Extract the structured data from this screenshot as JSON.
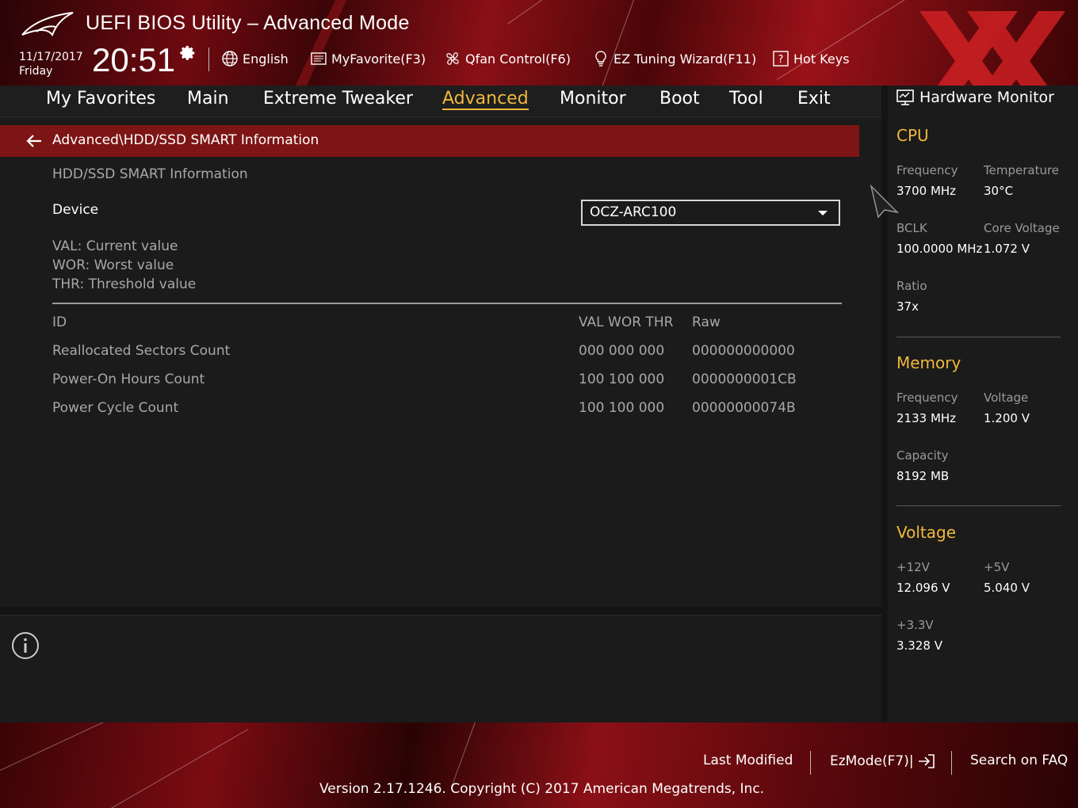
{
  "header": {
    "title": "UEFI BIOS Utility – Advanced Mode",
    "date": "11/17/2017",
    "day": "Friday",
    "time": "20:51",
    "toolbar": [
      {
        "label": "English",
        "icon": "globe-icon"
      },
      {
        "label": "MyFavorite(F3)",
        "icon": "favorite-list-icon"
      },
      {
        "label": "Qfan Control(F6)",
        "icon": "fan-icon"
      },
      {
        "label": "EZ Tuning Wizard(F11)",
        "icon": "lightbulb-icon"
      },
      {
        "label": "Hot Keys",
        "icon": "question-box-icon"
      }
    ]
  },
  "tabs": [
    {
      "label": "My Favorites",
      "active": false
    },
    {
      "label": "Main",
      "active": false
    },
    {
      "label": "Extreme Tweaker",
      "active": false
    },
    {
      "label": "Advanced",
      "active": true
    },
    {
      "label": "Monitor",
      "active": false
    },
    {
      "label": "Boot",
      "active": false
    },
    {
      "label": "Tool",
      "active": false
    },
    {
      "label": "Exit",
      "active": false
    }
  ],
  "main": {
    "breadcrumb": "Advanced\\HDD/SSD SMART Information",
    "section_title": "HDD/SSD SMART Information",
    "device_label": "Device",
    "device_value": "OCZ-ARC100",
    "legend": [
      "VAL:  Current value",
      "WOR: Worst value",
      "THR:  Threshold value"
    ],
    "table": {
      "headers": {
        "id": "ID",
        "values": "VAL WOR THR",
        "raw": "Raw"
      },
      "rows": [
        {
          "name": "Reallocated Sectors Count",
          "values": "000  000  000",
          "raw": "000000000000"
        },
        {
          "name": "Power-On Hours Count",
          "values": "100  100  000",
          "raw": "0000000001CB"
        },
        {
          "name": "Power Cycle Count",
          "values": "100  100  000",
          "raw": "00000000074B"
        }
      ]
    }
  },
  "hardware_monitor": {
    "title": "Hardware Monitor",
    "cpu": {
      "section": "CPU",
      "frequency_label": "Frequency",
      "frequency": "3700 MHz",
      "temperature_label": "Temperature",
      "temperature": "30°C",
      "bclk_label": "BCLK",
      "bclk": "100.0000 MHz",
      "core_voltage_label": "Core Voltage",
      "core_voltage": "1.072 V",
      "ratio_label": "Ratio",
      "ratio": "37x"
    },
    "memory": {
      "section": "Memory",
      "frequency_label": "Frequency",
      "frequency": "2133 MHz",
      "voltage_label": "Voltage",
      "voltage": "1.200 V",
      "capacity_label": "Capacity",
      "capacity": "8192 MB"
    },
    "voltage": {
      "section": "Voltage",
      "v12_label": "+12V",
      "v12": "12.096 V",
      "v5_label": "+5V",
      "v5": "5.040 V",
      "v33_label": "+3.3V",
      "v33": "3.328 V"
    }
  },
  "footer": {
    "last_modified": "Last Modified",
    "ezmode": "EzMode(F7)|",
    "search_faq": "Search on FAQ",
    "version": "Version 2.17.1246. Copyright (C) 2017 American Megatrends, Inc."
  },
  "colors": {
    "accent": "#f0b83c",
    "breadcrumb_bg": "#7d1515",
    "brand_red": "#8a1016",
    "background": "#1b1b1b"
  }
}
